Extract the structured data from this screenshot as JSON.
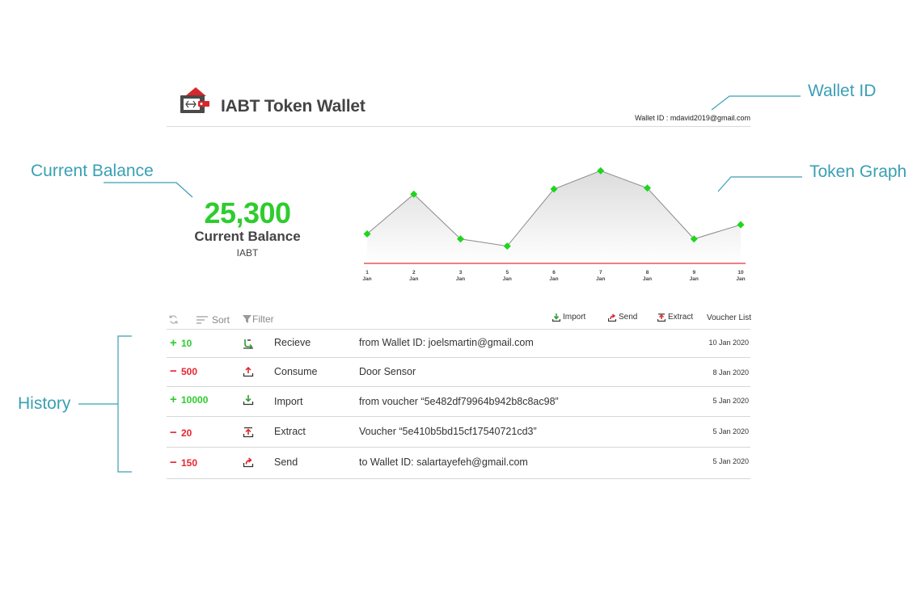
{
  "annotations": {
    "wallet_id": "Wallet ID",
    "current_balance": "Current Balance",
    "token_graph": "Token Graph",
    "history": "History"
  },
  "header": {
    "title": "IABT Token Wallet",
    "wallet_id_text": "Wallet ID : mdavid2019@gmail.com",
    "colors": {
      "logo_dark": "#4a4a4a",
      "logo_red": "#d9262c"
    }
  },
  "balance": {
    "value": "25,300",
    "label": "Current Balance",
    "unit": "IABT",
    "color": "#2ecc2e"
  },
  "chart_data": {
    "type": "area",
    "title": "",
    "xlabel": "",
    "ylabel": "",
    "categories": [
      "1 Jan",
      "2 Jan",
      "3 Jan",
      "5 Jan",
      "6 Jan",
      "7 Jan",
      "8 Jan",
      "9 Jan",
      "10 Jan"
    ],
    "tick_days": [
      "1",
      "2",
      "3",
      "5",
      "6",
      "7",
      "8",
      "9",
      "10"
    ],
    "tick_month": "Jan",
    "values": [
      29,
      68,
      24,
      17,
      73,
      91,
      74,
      24,
      38
    ],
    "ylim": [
      0,
      100
    ],
    "y_axis_visible": false,
    "grid": false,
    "colors": {
      "line": "#8a8a8a",
      "marker": "#1dd61d",
      "baseline": "#e8565a",
      "fill_top": "#e2e2e2"
    }
  },
  "toolbar": {
    "refresh_icon": "refresh-icon",
    "sort_label": "Sort",
    "filter_label": "Filter",
    "import_label": "Import",
    "send_label": "Send",
    "extract_label": "Extract",
    "voucher_label": "Voucher List"
  },
  "history": [
    {
      "sign": "+",
      "amount": "10",
      "type": "Recieve",
      "icon": "receive-icon",
      "description": "from Wallet ID: joelsmartin@gmail.com",
      "date": "10 Jan 2020"
    },
    {
      "sign": "−",
      "amount": "500",
      "type": "Consume",
      "icon": "consume-icon",
      "description": "Door Sensor",
      "date": "8 Jan 2020"
    },
    {
      "sign": "+",
      "amount": "10000",
      "type": "Import",
      "icon": "import-icon",
      "description": "from voucher “5e482df79964b942b8c8ac98”",
      "date": "5 Jan 2020"
    },
    {
      "sign": "−",
      "amount": "20",
      "type": "Extract",
      "icon": "extract-icon",
      "description": "Voucher “5e410b5bd15cf17540721cd3”",
      "date": "5 Jan 2020"
    },
    {
      "sign": "−",
      "amount": "150",
      "type": "Send",
      "icon": "send-icon",
      "description": "to Wallet ID: salartayefeh@gmail.com",
      "date": "5 Jan 2020"
    }
  ]
}
